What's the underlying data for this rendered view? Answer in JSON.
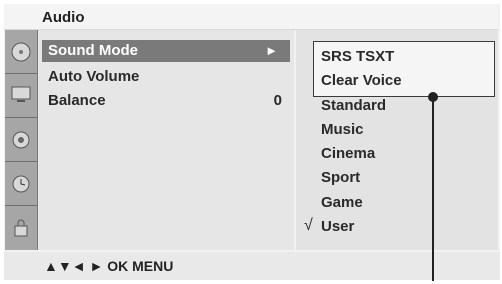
{
  "window": {
    "title": "Audio"
  },
  "sidebar": {
    "items": [
      {
        "icon": "disc-icon"
      },
      {
        "icon": "monitor-icon"
      },
      {
        "icon": "speaker-icon"
      },
      {
        "icon": "clock-icon"
      },
      {
        "icon": "lock-icon"
      }
    ]
  },
  "menu": {
    "items": [
      {
        "label": "Sound Mode",
        "arrow": "►",
        "selected": true
      },
      {
        "label": "Auto Volume",
        "value": ""
      },
      {
        "label": "Balance",
        "value": "0"
      }
    ]
  },
  "submenu": {
    "items": [
      {
        "label": "SRS TSXT"
      },
      {
        "label": "Clear Voice"
      },
      {
        "label": "Standard"
      },
      {
        "label": "Music"
      },
      {
        "label": "Cinema"
      },
      {
        "label": "Sport"
      },
      {
        "label": "Game"
      },
      {
        "label": "User",
        "check": "√"
      }
    ]
  },
  "footer": {
    "hint": "▲▼◄ ► OK MENU"
  },
  "colors": {
    "selected_bg": "#7a7a7a",
    "sidebar_bg": "#9a9a9a"
  }
}
